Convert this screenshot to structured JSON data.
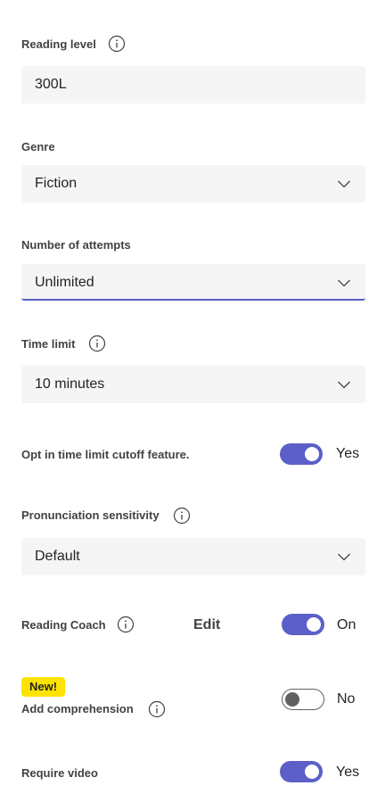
{
  "reading_level": {
    "label": "Reading level",
    "value": "300L"
  },
  "genre": {
    "label": "Genre",
    "value": "Fiction"
  },
  "attempts": {
    "label": "Number of attempts",
    "value": "Unlimited"
  },
  "time_limit": {
    "label": "Time limit",
    "value": "10 minutes"
  },
  "cutoff": {
    "label": "Opt in time limit cutoff feature.",
    "state": "Yes"
  },
  "pronunciation": {
    "label": "Pronunciation sensitivity",
    "value": "Default"
  },
  "reading_coach": {
    "label": "Reading Coach",
    "edit_label": "Edit",
    "state": "On"
  },
  "comprehension": {
    "badge": "New!",
    "label": "Add comprehension",
    "state": "No"
  },
  "require_video": {
    "label": "Require video",
    "state": "Yes"
  },
  "colors": {
    "accent": "#5b5fc7",
    "badge": "#fde300",
    "field_bg": "#f5f5f5"
  },
  "icons": {
    "info": "info-icon",
    "chevron": "chevron-down-icon"
  }
}
